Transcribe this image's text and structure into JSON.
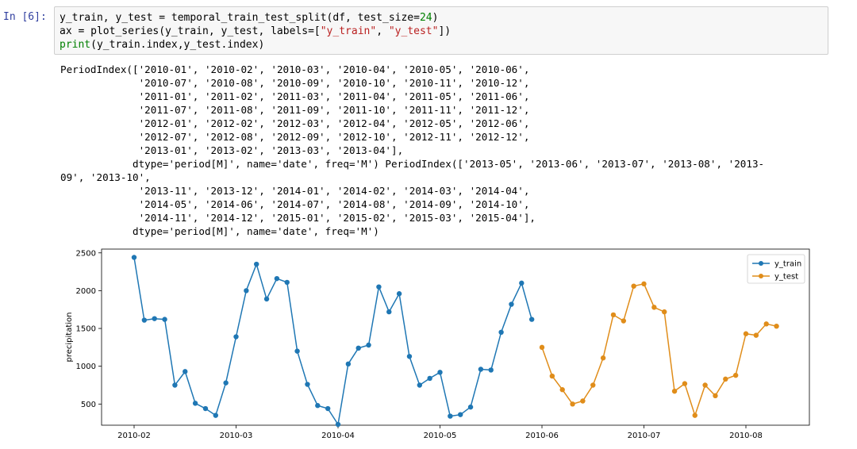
{
  "cell": {
    "prompt": "In [6]:",
    "code_lines": [
      [
        {
          "t": "y_train, y_test = temporal_train_test_split(df, test_size=",
          "c": ""
        },
        {
          "t": "24",
          "c": "k-num"
        },
        {
          "t": ")",
          "c": ""
        }
      ],
      [
        {
          "t": "ax = plot_series(y_train, y_test, labels=[",
          "c": ""
        },
        {
          "t": "\"y_train\"",
          "c": "k-str"
        },
        {
          "t": ", ",
          "c": ""
        },
        {
          "t": "\"y_test\"",
          "c": "k-str"
        },
        {
          "t": "])",
          "c": ""
        }
      ],
      [
        {
          "t": "print",
          "c": "k-fn"
        },
        {
          "t": "(y_train.index,y_test.index)",
          "c": ""
        }
      ]
    ]
  },
  "output": {
    "lines": [
      "PeriodIndex(['2010-01', '2010-02', '2010-03', '2010-04', '2010-05', '2010-06',",
      "             '2010-07', '2010-08', '2010-09', '2010-10', '2010-11', '2010-12',",
      "             '2011-01', '2011-02', '2011-03', '2011-04', '2011-05', '2011-06',",
      "             '2011-07', '2011-08', '2011-09', '2011-10', '2011-11', '2011-12',",
      "             '2012-01', '2012-02', '2012-03', '2012-04', '2012-05', '2012-06',",
      "             '2012-07', '2012-08', '2012-09', '2012-10', '2012-11', '2012-12',",
      "             '2013-01', '2013-02', '2013-03', '2013-04'],",
      "            dtype='period[M]', name='date', freq='M') PeriodIndex(['2013-05', '2013-06', '2013-07', '2013-08', '2013-",
      "09', '2013-10',",
      "             '2013-11', '2013-12', '2014-01', '2014-02', '2014-03', '2014-04',",
      "             '2014-05', '2014-06', '2014-07', '2014-08', '2014-09', '2014-10',",
      "             '2014-11', '2014-12', '2015-01', '2015-02', '2015-03', '2015-04'],",
      "            dtype='period[M]', name='date', freq='M')"
    ]
  },
  "chart_data": {
    "type": "line",
    "xlabel": "",
    "ylabel": "precipitation",
    "x_tick_labels": [
      "2010-02",
      "2010-03",
      "2010-04",
      "2010-05",
      "2010-06",
      "2010-07",
      "2010-08"
    ],
    "y_ticks": [
      500,
      1000,
      1500,
      2000,
      2500
    ],
    "ylim": [
      220,
      2550
    ],
    "legend_position": "top-right",
    "series": [
      {
        "name": "y_train",
        "color": "#1f77b4",
        "x_start": 0,
        "values": [
          2440,
          1610,
          1630,
          1620,
          750,
          930,
          510,
          440,
          350,
          780,
          1390,
          2000,
          2350,
          1890,
          2160,
          2110,
          1200,
          760,
          480,
          440,
          230,
          1030,
          1240,
          1280,
          2050,
          1720,
          1960,
          1130,
          750,
          840,
          920,
          340,
          360,
          460,
          960,
          950,
          1450,
          1820,
          2100,
          1620
        ]
      },
      {
        "name": "y_test",
        "color": "#e08d1a",
        "x_start": 40,
        "values": [
          1250,
          870,
          690,
          500,
          540,
          750,
          1110,
          1680,
          1600,
          2060,
          2090,
          1780,
          1720,
          670,
          770,
          350,
          750,
          610,
          830,
          880,
          1430,
          1410,
          1560,
          1530
        ]
      }
    ]
  }
}
